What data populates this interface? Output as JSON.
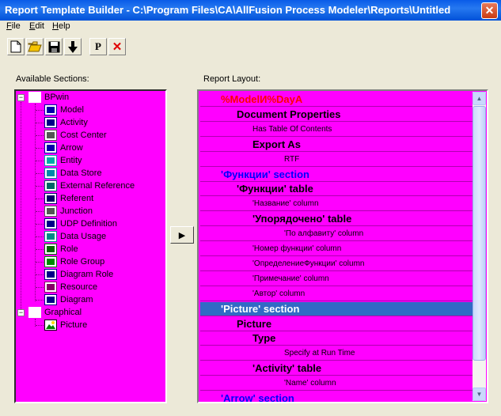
{
  "window": {
    "title": "Report Template Builder - C:\\Program Files\\CA\\AllFusion Process Modeler\\Reports\\Untitled",
    "close_glyph": "✕"
  },
  "menu": [
    {
      "label": "File",
      "mnemonic": "F",
      "rest": "ile"
    },
    {
      "label": "Edit",
      "mnemonic": "E",
      "rest": "dit"
    },
    {
      "label": "Help",
      "mnemonic": "H",
      "rest": "elp"
    }
  ],
  "toolbar": {
    "buttons": [
      "new-icon",
      "open-folder-icon",
      "save-icon",
      "down-arrow-icon",
      "p-icon",
      "delete-x-icon"
    ],
    "p_label": "P",
    "x_label": "✕"
  },
  "labels": {
    "available_sections": "Available Sections:",
    "report_layout": "Report Layout:"
  },
  "tree": {
    "root_bpwin": "BPwin",
    "bpwin_items": [
      "Model",
      "Activity",
      "Cost Center",
      "Arrow",
      "Entity",
      "Data Store",
      "External Reference",
      "Referent",
      "Junction",
      "UDP Definition",
      "Data Usage",
      "Role",
      "Role Group",
      "Diagram Role",
      "Resource",
      "Diagram"
    ],
    "root_graphical": "Graphical",
    "graphical_items": [
      "Picture"
    ],
    "expander_glyph": "−"
  },
  "layout_rows": [
    {
      "text": "%ModelИ%DayA",
      "indent": 1,
      "bold": true,
      "color": "#ff0000",
      "size": 13
    },
    {
      "text": "Document Properties",
      "indent": 2,
      "bold": true,
      "color": "#000000",
      "size": 13
    },
    {
      "text": "Has Table Of Contents",
      "indent": 3,
      "bold": false,
      "color": "#000000",
      "size": 10
    },
    {
      "text": "Export As",
      "indent": 3,
      "bold": true,
      "color": "#000000",
      "size": 13
    },
    {
      "text": "RTF",
      "indent": 4,
      "bold": false,
      "color": "#000000",
      "size": 10
    },
    {
      "text": "'Функции' section",
      "indent": 1,
      "bold": true,
      "color": "#0000ff",
      "size": 13
    },
    {
      "text": "'Функции' table",
      "indent": 2,
      "bold": true,
      "color": "#000000",
      "size": 13
    },
    {
      "text": "'Название' column",
      "indent": 3,
      "bold": false,
      "color": "#000000",
      "size": 10
    },
    {
      "text": "'Упорядочено' table",
      "indent": 3,
      "bold": true,
      "color": "#000000",
      "size": 13
    },
    {
      "text": "'По алфавиту' column",
      "indent": 4,
      "bold": false,
      "color": "#000000",
      "size": 10
    },
    {
      "text": "'Номер функции' column",
      "indent": 3,
      "bold": false,
      "color": "#000000",
      "size": 10
    },
    {
      "text": "'ОпределениеФункции' column",
      "indent": 3,
      "bold": false,
      "color": "#000000",
      "size": 10
    },
    {
      "text": "'Примечание' column",
      "indent": 3,
      "bold": false,
      "color": "#000000",
      "size": 10
    },
    {
      "text": "'Автор' column",
      "indent": 3,
      "bold": false,
      "color": "#000000",
      "size": 10
    },
    {
      "text": "'Picture' section",
      "indent": 1,
      "bold": true,
      "color": "#ffffff",
      "size": 13,
      "selected": true
    },
    {
      "text": "Picture",
      "indent": 2,
      "bold": true,
      "color": "#000000",
      "size": 13
    },
    {
      "text": "Type",
      "indent": 3,
      "bold": true,
      "color": "#000000",
      "size": 13
    },
    {
      "text": "Specify at Run Time",
      "indent": 4,
      "bold": false,
      "color": "#000000",
      "size": 10
    },
    {
      "text": "'Activity' table",
      "indent": 3,
      "bold": true,
      "color": "#000000",
      "size": 13
    },
    {
      "text": "'Name' column",
      "indent": 4,
      "bold": false,
      "color": "#000000",
      "size": 10
    },
    {
      "text": "'Arrow' section",
      "indent": 1,
      "bold": true,
      "color": "#0000ff",
      "size": 13
    }
  ],
  "arrow_button_glyph": "▶",
  "scroll": {
    "up_glyph": "▲",
    "down_glyph": "▼"
  },
  "colors": {
    "panel_bg": "#ff00ff",
    "selection": "#316ac5"
  }
}
